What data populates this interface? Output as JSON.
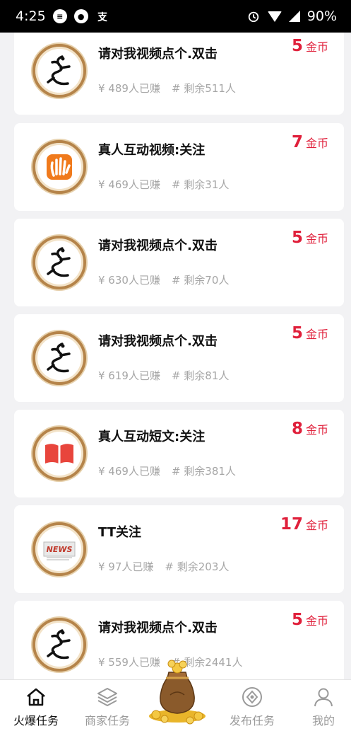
{
  "status_bar": {
    "time": "4:25",
    "battery": "90%"
  },
  "tasks": [
    {
      "title": "请对我视频点个.双击",
      "reward": "5",
      "unit": "金币",
      "earned": "¥ 489人已赚",
      "remaining": "# 剩余511人",
      "icon": "dragon-logo"
    },
    {
      "title": "真人互动视频:关注",
      "reward": "7",
      "unit": "金币",
      "earned": "¥ 469人已赚",
      "remaining": "# 剩余31人",
      "icon": "hand-logo"
    },
    {
      "title": "请对我视频点个.双击",
      "reward": "5",
      "unit": "金币",
      "earned": "¥ 630人已赚",
      "remaining": "# 剩余70人",
      "icon": "dragon-logo"
    },
    {
      "title": "请对我视频点个.双击",
      "reward": "5",
      "unit": "金币",
      "earned": "¥ 619人已赚",
      "remaining": "# 剩余81人",
      "icon": "dragon-logo"
    },
    {
      "title": "真人互动短文:关注",
      "reward": "8",
      "unit": "金币",
      "earned": "¥ 469人已赚",
      "remaining": "# 剩余381人",
      "icon": "book-logo"
    },
    {
      "title": "TT关注",
      "reward": "17",
      "unit": "金币",
      "earned": "¥ 97人已赚",
      "remaining": "# 剩余203人",
      "icon": "news-logo"
    },
    {
      "title": "请对我视频点个.双击",
      "reward": "5",
      "unit": "金币",
      "earned": "¥ 559人已赚",
      "remaining": "# 剩余2441人",
      "icon": "dragon-logo"
    }
  ],
  "tabbar": {
    "home": "火爆任务",
    "merchant": "商家任务",
    "publish": "发布任务",
    "mine": "我的"
  },
  "colors": {
    "accent": "#e0203b",
    "logo_ring": "#b5844a"
  }
}
